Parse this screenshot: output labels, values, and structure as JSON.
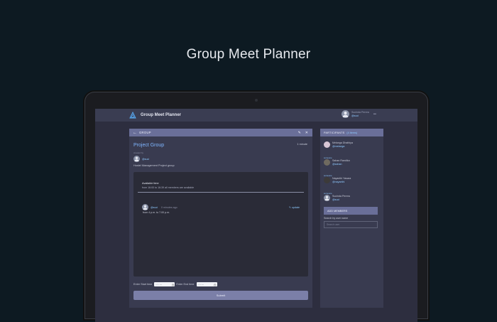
{
  "hero": {
    "title": "Group Meet Planner"
  },
  "app": {
    "name": "Group Meet Planner",
    "user": {
      "name": "Sucinda Perera",
      "handle": "@suci"
    }
  },
  "group": {
    "header_label": "GROUP",
    "title": "Project Group",
    "duration": "1 minute",
    "created_by_label": "created by",
    "creator_handle": "@suci",
    "description": "Hostel Management Project group",
    "availability": {
      "title": "Available time",
      "text": "from 16:00 to 16:39 all members are available"
    },
    "message": {
      "handle": "@suci",
      "time": "0 minutes ago",
      "action": "update",
      "text": "from 4 p.m. to 7.00 p.m."
    },
    "start_label": "Enter Start time",
    "end_label": "Enter End time",
    "time_placeholder": "--:-- ---",
    "submit_label": "Submit"
  },
  "participants": {
    "header": "PARTICIPANTS",
    "count": "(4 items)",
    "items": [
      {
        "role": "",
        "name": "Melanga Dhathiya",
        "handle": "@melanga"
      },
      {
        "role": "someone",
        "name": "Sahan Randika",
        "handle": "@sahan"
      },
      {
        "role": "someone",
        "name": "Nayanthi Yasara",
        "handle": "@nayanthi"
      },
      {
        "role": "someone",
        "name": "Sucinda Perera",
        "handle": "@suci"
      }
    ],
    "add_label": "ADD MEMBERS",
    "search_label": "Search by user name",
    "search_placeholder": "Search user"
  },
  "colors": {
    "accent": "#7fb6ff",
    "header": "#6a6f99",
    "panel": "#393b50"
  }
}
